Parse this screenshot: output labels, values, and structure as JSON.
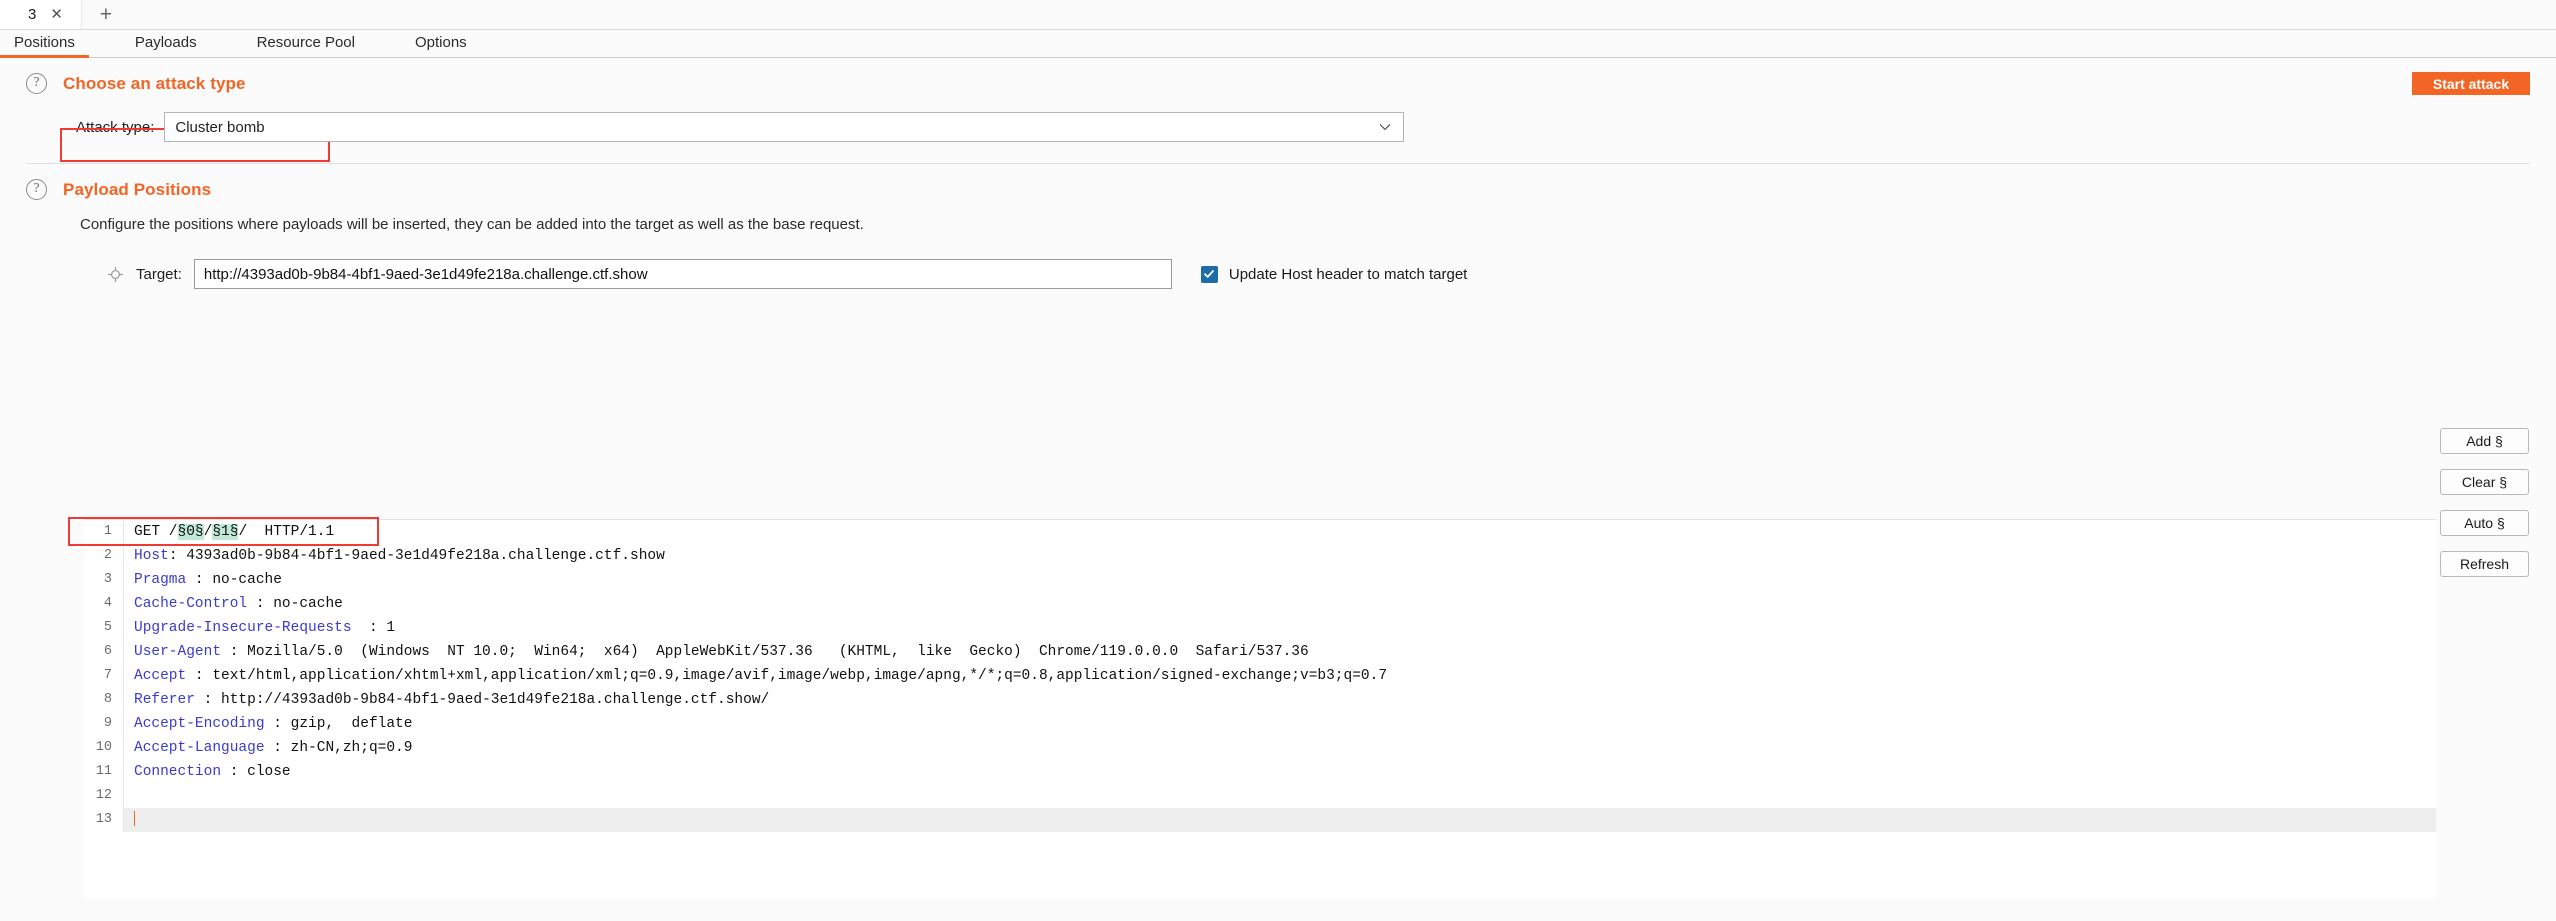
{
  "window": {
    "tab_label": "3",
    "close_icon": "close-icon",
    "newtab_icon": "plus-icon"
  },
  "nav": {
    "tabs": [
      {
        "label": "Positions",
        "active": true
      },
      {
        "label": "Payloads",
        "active": false
      },
      {
        "label": "Resource Pool",
        "active": false
      },
      {
        "label": "Options",
        "active": false
      }
    ]
  },
  "attack": {
    "section_title": "Choose an attack type",
    "help_icon": "question-mark-icon",
    "label": "Attack type:",
    "value": "Cluster bomb",
    "chevron_icon": "chevron-down-icon",
    "start_button": "Start attack"
  },
  "positions": {
    "section_title": "Payload Positions",
    "help_icon": "question-mark-icon",
    "description": "Configure the positions where payloads will be inserted, they can be added into the target as well as the base request.",
    "target_icon": "crosshair-icon",
    "target_label": "Target:",
    "target_value": "http://4393ad0b-9b84-4bf1-9aed-3e1d49fe218a.challenge.ctf.show",
    "host_checkbox_label": "Update Host header to match target",
    "host_checkbox_checked": true,
    "buttons": [
      "Add §",
      "Clear §",
      "Auto §",
      "Refresh"
    ]
  },
  "request": {
    "lines": [
      {
        "n": "1",
        "segments": [
          {
            "t": "GET /",
            "c": "plain"
          },
          {
            "t": "§0§",
            "c": "mark"
          },
          {
            "t": "/",
            "c": "plain"
          },
          {
            "t": "§1§",
            "c": "mark"
          },
          {
            "t": "/  HTTP/1.1",
            "c": "plain"
          }
        ]
      },
      {
        "n": "2",
        "segments": [
          {
            "t": "Host",
            "c": "hdr"
          },
          {
            "t": ": 4393ad0b-9b84-4bf1-9aed-3e1d49fe218a.challenge.ctf.show",
            "c": "plain"
          }
        ]
      },
      {
        "n": "3",
        "segments": [
          {
            "t": "Pragma",
            "c": "hdr"
          },
          {
            "t": " : no-cache",
            "c": "plain"
          }
        ]
      },
      {
        "n": "4",
        "segments": [
          {
            "t": "Cache-Control",
            "c": "hdr"
          },
          {
            "t": " : no-cache",
            "c": "plain"
          }
        ]
      },
      {
        "n": "5",
        "segments": [
          {
            "t": "Upgrade-Insecure-Requests",
            "c": "hdr"
          },
          {
            "t": "  : 1",
            "c": "plain"
          }
        ]
      },
      {
        "n": "6",
        "segments": [
          {
            "t": "User-Agent",
            "c": "hdr"
          },
          {
            "t": " : Mozilla/5.0  (Windows  NT 10.0;  Win64;  x64)  AppleWebKit/537.36   (KHTML,  like  Gecko)  Chrome/119.0.0.0  Safari/537.36",
            "c": "plain"
          }
        ]
      },
      {
        "n": "7",
        "segments": [
          {
            "t": "Accept",
            "c": "hdr"
          },
          {
            "t": " : text/html,application/xhtml+xml,application/xml;q=0.9,image/avif,image/webp,image/apng,*/*;q=0.8,application/signed-exchange;v=b3;q=0.7",
            "c": "plain"
          }
        ]
      },
      {
        "n": "8",
        "segments": [
          {
            "t": "Referer",
            "c": "hdr"
          },
          {
            "t": " : http://4393ad0b-9b84-4bf1-9aed-3e1d49fe218a.challenge.ctf.show/",
            "c": "plain"
          }
        ]
      },
      {
        "n": "9",
        "segments": [
          {
            "t": "Accept-Encoding",
            "c": "hdr"
          },
          {
            "t": " : gzip,  deflate",
            "c": "plain"
          }
        ]
      },
      {
        "n": "10",
        "segments": [
          {
            "t": "Accept-Language",
            "c": "hdr"
          },
          {
            "t": " : zh-CN,zh;q=0.9",
            "c": "plain"
          }
        ]
      },
      {
        "n": "11",
        "segments": [
          {
            "t": "Connection",
            "c": "hdr"
          },
          {
            "t": " : close",
            "c": "plain"
          }
        ]
      },
      {
        "n": "12",
        "segments": []
      },
      {
        "n": "13",
        "segments": [],
        "current": true
      }
    ]
  },
  "colors": {
    "accent": "#f26524",
    "annotation": "#ef3b35",
    "header_blue": "#3a3ad0",
    "marker_green": "#bfe8d6",
    "checkbox_blue": "#1b6ca8"
  }
}
